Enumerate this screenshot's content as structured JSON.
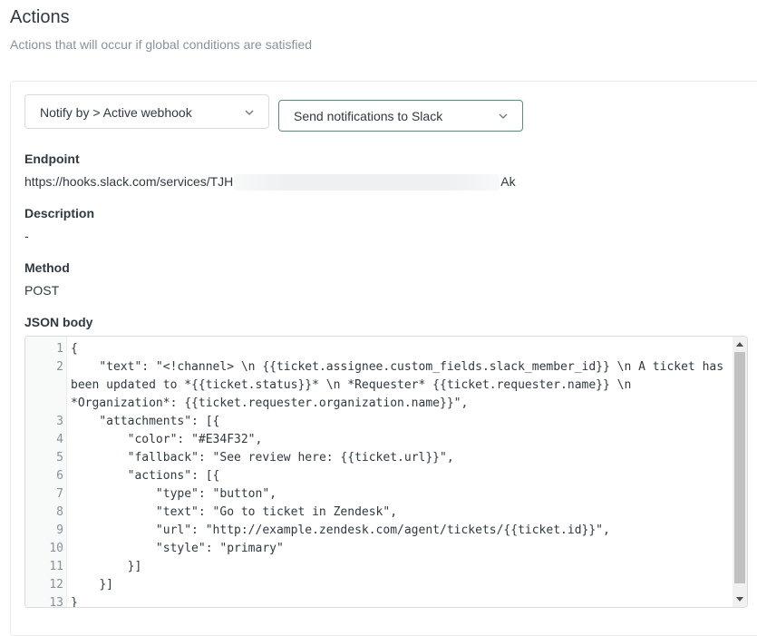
{
  "header": {
    "title": "Actions",
    "subtitle": "Actions that will occur if global conditions are satisfied"
  },
  "selects": {
    "notify_by": "Notify by > Active webhook",
    "webhook": "Send notifications to Slack"
  },
  "endpoint": {
    "label": "Endpoint",
    "prefix": "https://hooks.slack.com/services/TJH",
    "suffix": "Ak"
  },
  "description": {
    "label": "Description",
    "value": "-"
  },
  "method": {
    "label": "Method",
    "value": "POST"
  },
  "json_body": {
    "label": "JSON body",
    "lines": [
      {
        "n": "1",
        "text": "{"
      },
      {
        "n": "2",
        "text": "    \"text\": \"<!channel> \\n {{ticket.assignee.custom_fields.slack_member_id}} \\n A ticket has been updated to *{{ticket.status}}* \\n *Requester* {{ticket.requester.name}} \\n *Organization*: {{ticket.requester.organization.name}}\","
      },
      {
        "n": "3",
        "text": "    \"attachments\": [{"
      },
      {
        "n": "4",
        "text": "        \"color\": \"#E34F32\","
      },
      {
        "n": "5",
        "text": "        \"fallback\": \"See review here: {{ticket.url}}\","
      },
      {
        "n": "6",
        "text": "        \"actions\": [{"
      },
      {
        "n": "7",
        "text": "            \"type\": \"button\","
      },
      {
        "n": "8",
        "text": "            \"text\": \"Go to ticket in Zendesk\","
      },
      {
        "n": "9",
        "text": "            \"url\": \"http://example.zendesk.com/agent/tickets/{{ticket.id}}\","
      },
      {
        "n": "10",
        "text": "            \"style\": \"primary\""
      },
      {
        "n": "11",
        "text": "        }]"
      },
      {
        "n": "12",
        "text": "    }]"
      },
      {
        "n": "13",
        "text": "}"
      }
    ]
  }
}
